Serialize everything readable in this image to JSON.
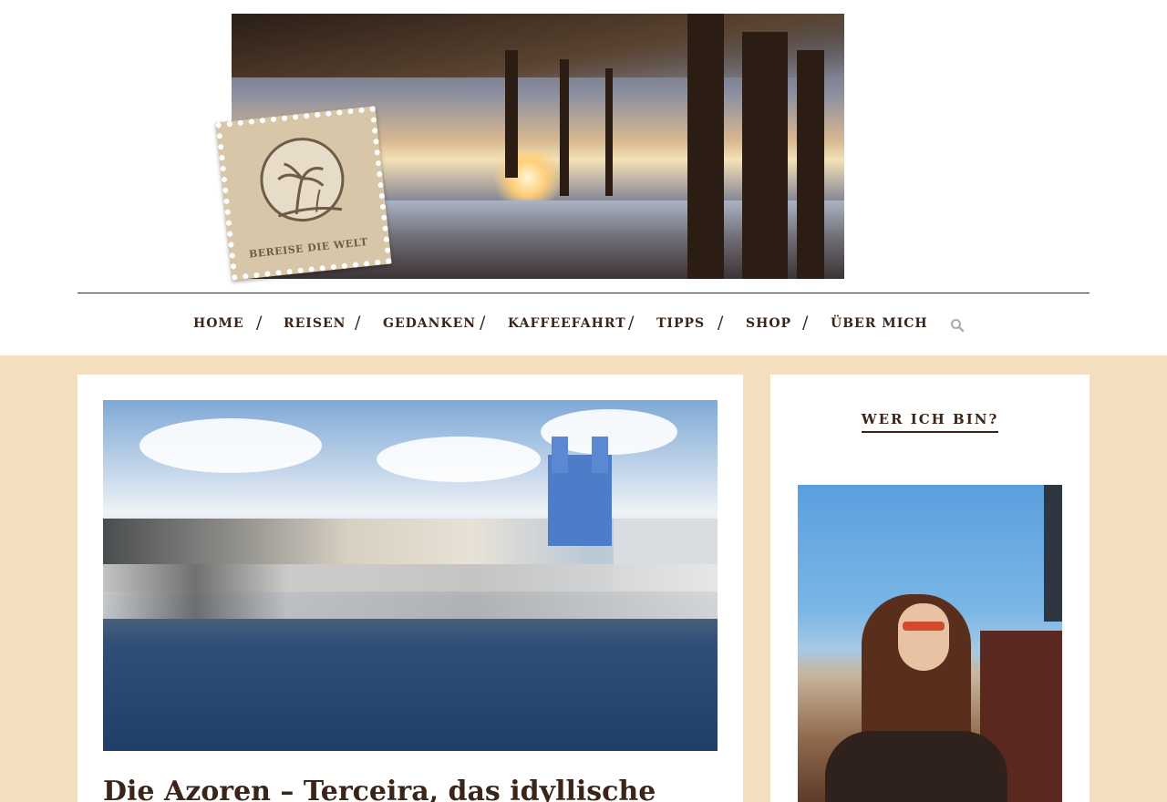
{
  "header": {
    "logo_text": "BEREISE DIE WELT",
    "banner_alt": "pier-at-sunset-banner"
  },
  "nav": {
    "items": [
      {
        "label": "HOME"
      },
      {
        "label": "REISEN"
      },
      {
        "label": "GEDANKEN"
      },
      {
        "label": "KAFFEEFAHRT"
      },
      {
        "label": "TIPPS"
      },
      {
        "label": "SHOP"
      },
      {
        "label": "ÜBER MICH"
      }
    ],
    "separator": "/",
    "search_icon": "search-icon"
  },
  "main": {
    "post": {
      "image": "azores-harbor-photo",
      "title": "Die Azoren – Terceira, das idyllische"
    }
  },
  "sidebar": {
    "widget_title": "WER ICH BIN?",
    "profile_image": "author-portrait-photo"
  },
  "colors": {
    "accent": "#3b2418",
    "background": "#f3dfbf",
    "card": "#ffffff"
  }
}
